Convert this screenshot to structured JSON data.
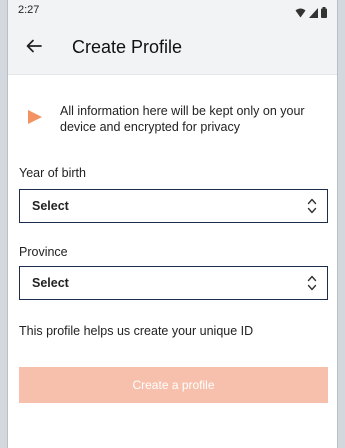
{
  "status_bar": {
    "time": "2:27",
    "icons": [
      "wifi-icon",
      "signal-icon",
      "battery-icon"
    ]
  },
  "header": {
    "back_icon": "arrow-left-icon",
    "title": "Create Profile"
  },
  "notice": {
    "icon": "play-triangle-icon",
    "text": "All information here will be kept only on your device and encrypted for privacy",
    "icon_color": "#f39263"
  },
  "form": {
    "year_of_birth": {
      "label": "Year of birth",
      "value": "Select"
    },
    "province": {
      "label": "Province",
      "value": "Select"
    }
  },
  "helper_text": "This profile helps us create your unique ID",
  "create_button": {
    "label": "Create a profile",
    "color": "#f7c0ac"
  }
}
